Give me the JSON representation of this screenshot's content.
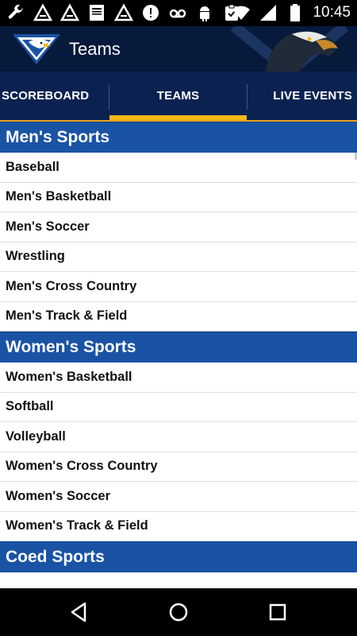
{
  "status_bar": {
    "time": "10:45",
    "left_icons": [
      "wrench-icon",
      "triangle-notification-icon",
      "triangle-notification-icon",
      "news-icon",
      "triangle-notification-icon",
      "alert-icon",
      "voicemail-icon",
      "android-icon",
      "clipboard-icon"
    ],
    "right_icons": [
      "wifi-icon",
      "signal-icon",
      "battery-icon"
    ]
  },
  "app_bar": {
    "title": "Teams"
  },
  "tabs": [
    {
      "label": "SCOREBOARD",
      "selected": false
    },
    {
      "label": "TEAMS",
      "selected": true
    },
    {
      "label": "LIVE EVENTS",
      "selected": false
    }
  ],
  "sections": [
    {
      "title": "Men's Sports",
      "items": [
        "Baseball",
        "Men's Basketball",
        "Men's Soccer",
        "Wrestling",
        "Men's Cross Country",
        "Men's Track & Field"
      ]
    },
    {
      "title": "Women's Sports",
      "items": [
        "Women's Basketball",
        "Softball",
        "Volleyball",
        "Women's Cross Country",
        "Women's Soccer",
        "Women's Track & Field"
      ]
    },
    {
      "title": "Coed Sports",
      "items": []
    }
  ],
  "colors": {
    "app_bar": "#071a3c",
    "tab_bar": "#0b2251",
    "tab_indicator": "#f5b818",
    "section_header": "#1a53a4"
  },
  "nav_bar": [
    "back-icon",
    "home-icon",
    "recents-icon"
  ]
}
